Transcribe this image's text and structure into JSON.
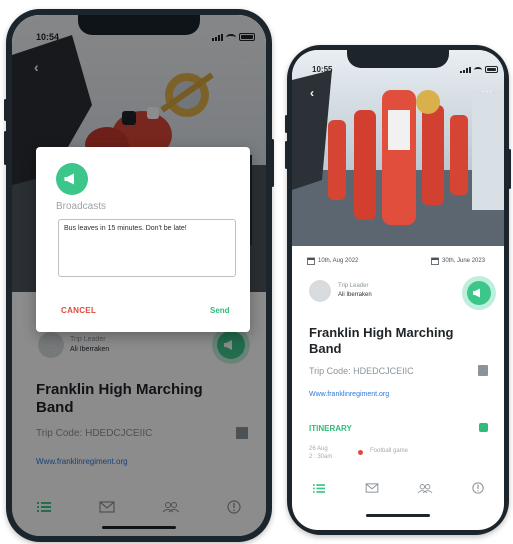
{
  "phone1": {
    "time": "10:54",
    "dialog": {
      "title": "Broadcasts",
      "message": "Bus leaves in 15 minutes. Don't be late!",
      "cancel_label": "CANCEL",
      "send_label": "Send"
    },
    "leader": {
      "role": "Trip Leader",
      "name": "Ali Iberraken",
      "avatar_text": "..."
    },
    "trip": {
      "title": "Franklin High Marching Band",
      "code": "Trip Code: HDEDCJCEIIC",
      "link": "Www.franklinregiment.org"
    }
  },
  "phone2": {
    "time": "10:55",
    "start_date": "10th, Aug 2022",
    "end_date": "30th, June 2023",
    "leader": {
      "role": "Trip Leader",
      "name": "Ali Iberraken"
    },
    "trip": {
      "title": "Franklin High Marching Band",
      "code": "Trip Code: HDEDCJCEIIC",
      "link": "Www.franklinregiment.org"
    },
    "itinerary": {
      "heading": "ITINERARY",
      "date_line1": "26 Aug",
      "date_line2": "2 : 30am",
      "event": "Football game"
    }
  },
  "colors": {
    "accent": "#3cc68a",
    "danger": "#e04a3a",
    "link": "#2d78d8"
  },
  "icons": [
    "back-chevron-icon",
    "more-icon",
    "megaphone-icon",
    "share-icon",
    "list-icon",
    "mail-icon",
    "people-icon",
    "info-icon",
    "calendar-icon",
    "checkbox-icon"
  ]
}
